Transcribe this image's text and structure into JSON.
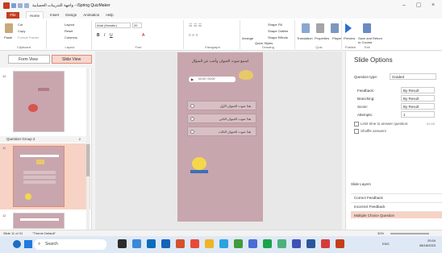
{
  "window": {
    "title": "واجهة التدريبات الحسابية - iSpring QuizMaker",
    "minimize": "–",
    "maximize": "▢",
    "close": "×"
  },
  "menu": {
    "file": "File",
    "tabs": [
      "Home",
      "Insert",
      "Design",
      "Animation",
      "Help"
    ],
    "active": "Home"
  },
  "ribbon": {
    "paste": "Paste",
    "cut": "Cut",
    "copy": "Copy",
    "format_painter": "Format Painter",
    "clipboard": "Clipboard",
    "layout": "Layout",
    "reset": "Reset",
    "columns": "Columns",
    "layout_group": "Layout",
    "font_name": "Arial (Header)",
    "font_size": "20",
    "font_group": "Font",
    "paragraph_group": "Paragraph",
    "arrange": "Arrange",
    "quick_styles": "Quick Styles",
    "shape_fill": "Shape Fill",
    "shape_outline": "Shape Outline",
    "shape_effects": "Shape Effects",
    "drawing": "Drawing",
    "translation": "Translation",
    "properties": "Properties",
    "player": "Player",
    "quiz_group": "Quiz",
    "preview": "Preview",
    "save_return": "Save and Return to Course",
    "publish": "Publish",
    "exit": "Exit"
  },
  "view": {
    "form": "Form View",
    "slide": "Slide View"
  },
  "slides": {
    "n1": "10",
    "group_label": "Question Group 2",
    "group_count": "2",
    "n2": "11",
    "n3": "12"
  },
  "slide": {
    "title": "اسمع صوت الحيوان وأجب عن السؤال",
    "player_time": "00:00 / 00:00",
    "answers": [
      "هذا صوت الحيوان الأول",
      "هذا صوت الحيوان الثاني",
      "هذا صوت الحيوان الثالث"
    ]
  },
  "options": {
    "title": "Slide Options",
    "qtype_label": "Question type:",
    "qtype": "Graded",
    "feedback_label": "Feedback:",
    "feedback": "By Result",
    "branching_label": "Branching:",
    "branching": "By Result",
    "score_label": "Score:",
    "score": "By Result",
    "attempts_label": "Attempts:",
    "attempts": "1",
    "limit_time": "Limit time to answer question:",
    "limit_value": "01:00",
    "shuffle": "Shuffle answers",
    "layers_head": "Slide Layers",
    "layers": [
      "Correct Feedback",
      "Incorrect Feedback",
      "Multiple Choice Question"
    ],
    "active_layer": "Multiple Choice Question"
  },
  "status": {
    "slide": "Slide 11 of 31",
    "theme": "\"Theme Default\"",
    "zoom": "30%"
  },
  "taskbar": {
    "search": "Search",
    "time": "20:54",
    "date": "08/18/2023",
    "lang": "ENG"
  },
  "colors": {
    "accent": "#c43e1c",
    "slide_bg": "#c8a6ad",
    "selection": "#f7d3c6"
  }
}
